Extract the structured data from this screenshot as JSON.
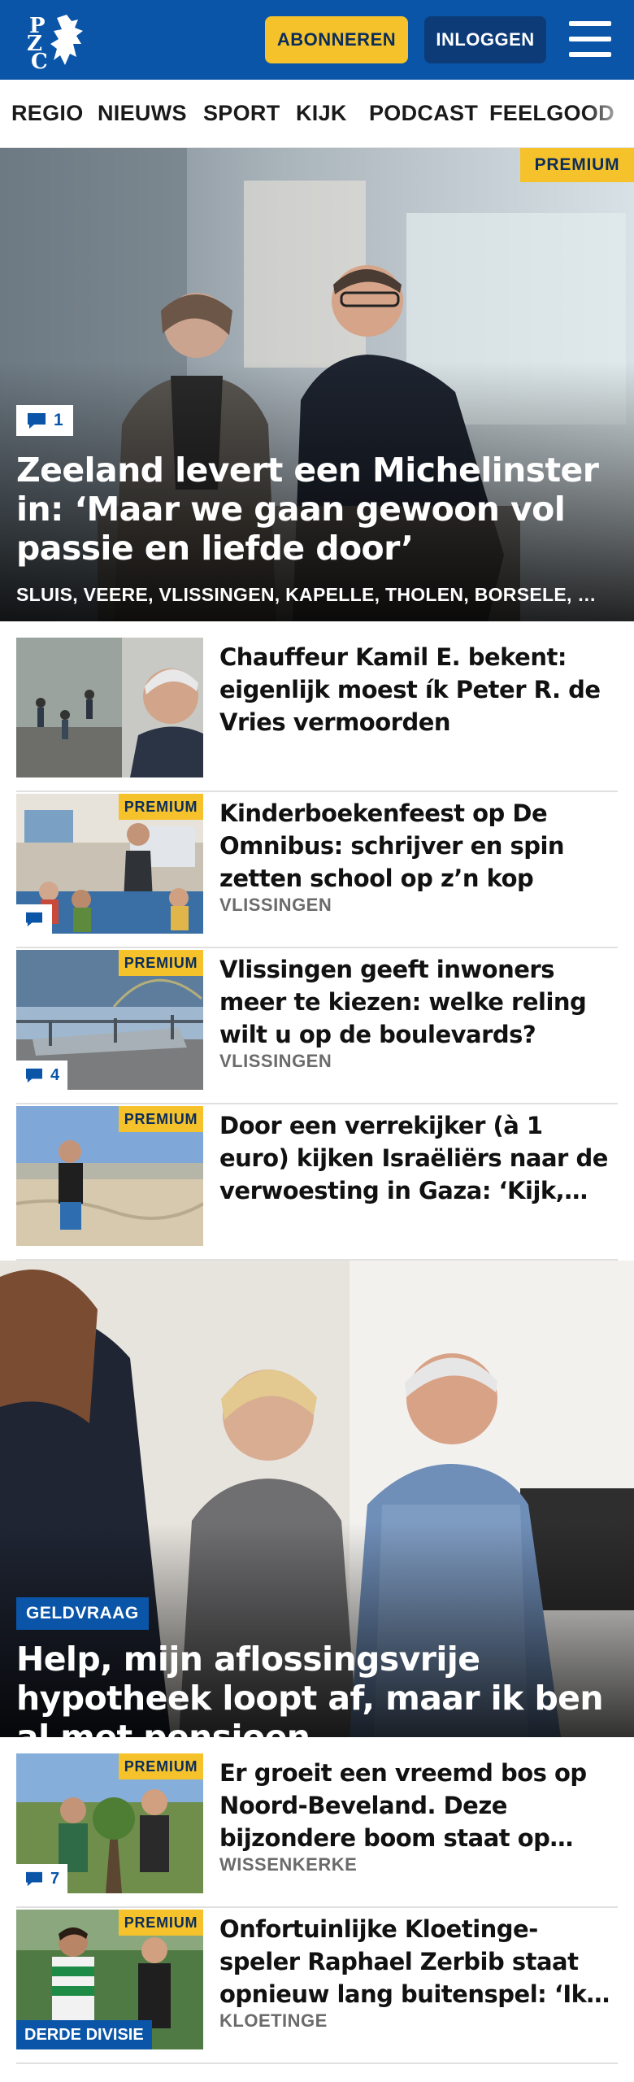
{
  "brand": {
    "logo_text": "PZC",
    "primary_color": "#0a55a8",
    "accent_color": "#f5c22b"
  },
  "header": {
    "subscribe_label": "ABONNEREN",
    "login_label": "INLOGGEN",
    "menu_icon": "hamburger-icon"
  },
  "nav": {
    "items": [
      "REGIO",
      "NIEUWS",
      "SPORT",
      "KIJK",
      "PODCAST",
      "FEELGOOD"
    ]
  },
  "hero": {
    "premium_label": "PREMIUM",
    "comments": "1",
    "title": "Zeeland levert een Michelinster in: ‘Maar we gaan gewoon vol passie en liefde door’",
    "locations": "SLUIS, VEERE, VLISSINGEN, KAPELLE, THOLEN, BORSELE, …"
  },
  "articles": [
    {
      "title": "Chauffeur Kamil E. bekent: eigenlijk moest ík Peter R. de Vries vermoorden",
      "location": "",
      "premium": false,
      "comments": ""
    },
    {
      "title": "Kinderboekenfeest op De Omnibus: schrijver en spin zetten school op z’n kop",
      "location": "VLISSINGEN",
      "premium": true,
      "premium_label": "PREMIUM",
      "comments": ""
    },
    {
      "title": "Vlissingen geeft inwoners meer te kiezen: welke reling wilt u op de boulevards?",
      "location": "VLISSINGEN",
      "premium": true,
      "premium_label": "PREMIUM",
      "comments": "4"
    },
    {
      "title": "Door een verrekijker (à 1 euro) kijken Israëliërs naar de verwoesting in Gaza: ‘Kijk, daar…",
      "location": "",
      "premium": true,
      "premium_label": "PREMIUM",
      "comments": ""
    }
  ],
  "feature": {
    "tag": "GELDVRAAG",
    "title": "Help, mijn aflossingsvrije hypotheek loopt af, maar ik ben al met pensioen"
  },
  "articles2": [
    {
      "title": "Er groeit een vreemd bos op Noord-Beveland. Deze bijzondere boom staat op steeds meer…",
      "location": "WISSENKERKE",
      "premium_label": "PREMIUM",
      "comments": "7"
    },
    {
      "title": "Onfortuinlijke Kloetinge-speler Raphael Zerbib staat opnieuw lang buitenspel: ‘Ik ga hetzelfd…",
      "location": "KLOETINGE",
      "premium_label": "PREMIUM",
      "division": "DERDE DIVISIE"
    }
  ]
}
